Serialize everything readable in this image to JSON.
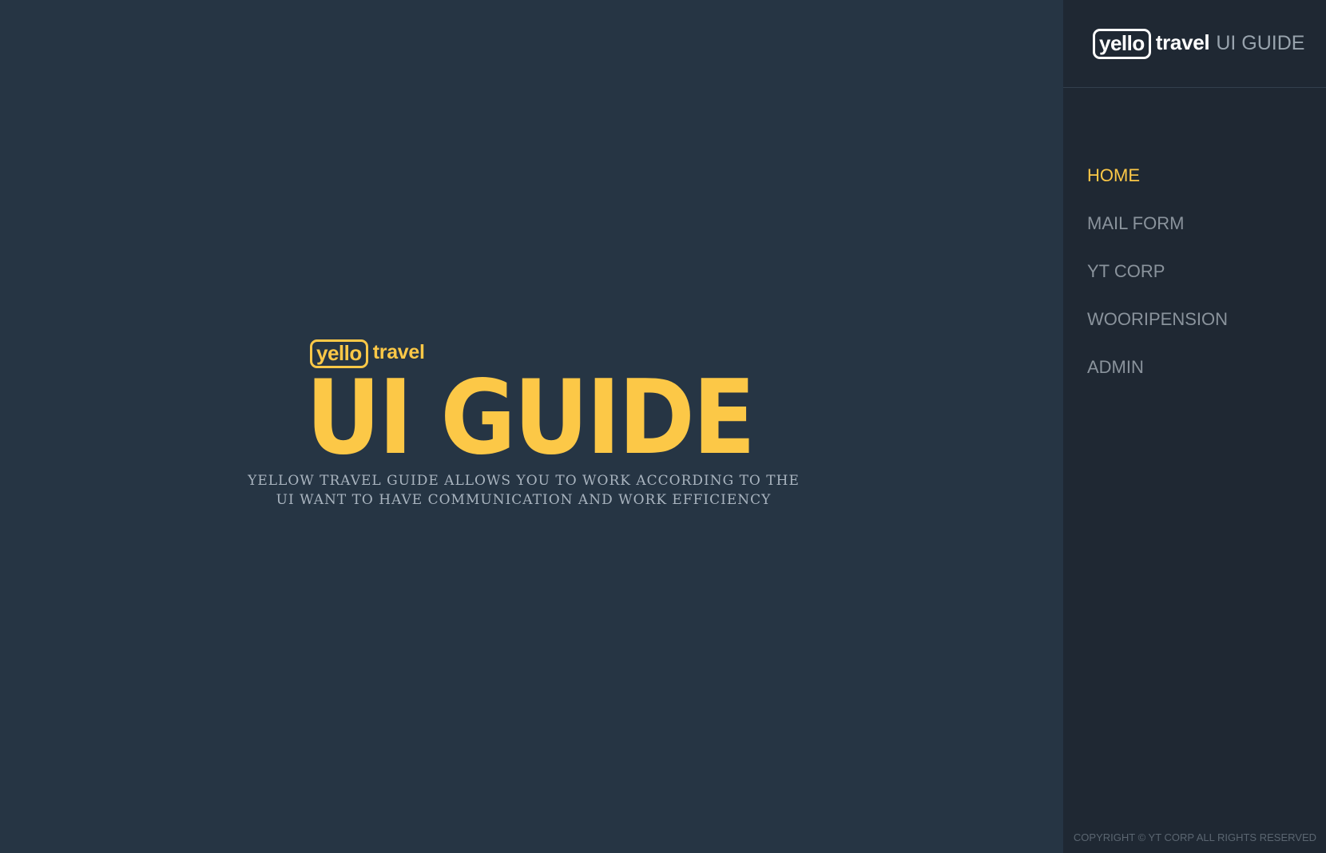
{
  "brand": {
    "logo_box_text": "yello",
    "logo_word": "travel",
    "logo_suffix": "UI GUIDE"
  },
  "hero": {
    "logo_box_text": "yello",
    "logo_word": "travel",
    "title": "UI GUIDE",
    "description_line1": "YELLOW TRAVEL GUIDE ALLOWS YOU TO WORK ACCORDING TO THE",
    "description_line2": "UI WANT TO HAVE COMMUNICATION AND WORK EFFICIENCY"
  },
  "sidebar": {
    "nav_items": [
      {
        "label": "HOME",
        "active": true
      },
      {
        "label": "MAIL FORM",
        "active": false
      },
      {
        "label": "YT CORP",
        "active": false
      },
      {
        "label": "WOORIPENSION",
        "active": false
      },
      {
        "label": "ADMIN",
        "active": false
      }
    ],
    "copyright": "COPYRIGHT © YT CORP ALL RIGHTS RESERVED"
  },
  "colors": {
    "main_background": "#263544",
    "sidebar_background": "#1f2833",
    "accent_yellow": "#fcc847",
    "nav_text": "#8a939c",
    "description_text": "#a9b4bf"
  }
}
